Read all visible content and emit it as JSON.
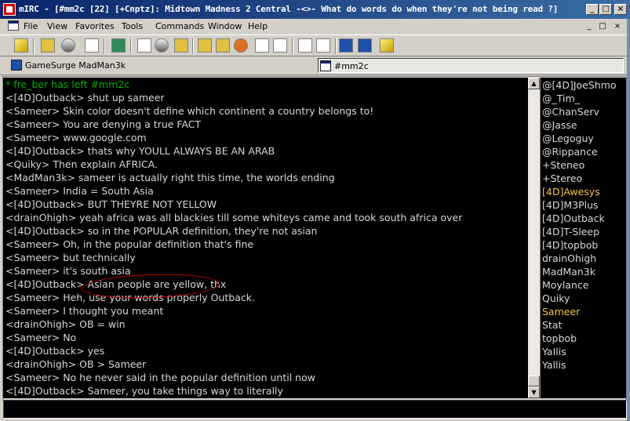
{
  "window": {
    "title": "mIRC - [#mm2c [22] [+Cnptz]: Midtown Madness 2 Central -<>- What do words do when they're not being read ?]",
    "controls": [
      "_",
      "□",
      "×"
    ]
  },
  "menubar": {
    "items": [
      "File",
      "View",
      "Favorites",
      "Tools",
      "Commands",
      "Window",
      "Help"
    ],
    "mdi_controls": [
      "_",
      "□",
      "×"
    ]
  },
  "switchbar": {
    "tabs": [
      {
        "label": "GameSurge MadMan3k"
      },
      {
        "label": "#mm2c"
      }
    ]
  },
  "chat": {
    "lines": [
      "* fre_ber has left #mm2c",
      "<[4D]Outback> shut up sameer",
      "<Sameer> Skin color doesn't define which continent a country belongs to!",
      "<Sameer> You are denying a true FACT",
      "<Sameer> www.google.com",
      "<[4D]Outback> thats why YOULL ALWAYS BE AN ARAB",
      "<Quiky> Then explain AFRICA.",
      "<MadMan3k> sameer is actually right this time, the worlds ending",
      "<Sameer> India = South Asia",
      "<[4D]Outback> BUT THEYRE NOT YELLOW",
      "<drainOhigh> yeah africa was all blackies till some whiteys came and took south africa over",
      "<[4D]Outback> so in the POPULAR definition, they're not asian",
      "<Sameer> Oh, in the popular definition that's fine",
      "<Sameer> but technically",
      "<Sameer> it's south asia",
      "<[4D]Outback> Asian people are yellow, thx",
      "<Sameer> Heh, use your words properly Outback.",
      "<Sameer> I thought you meant",
      "<drainOhigh> OB = win",
      "<Sameer> No",
      "<[4D]Outback> yes",
      "<drainOhigh> OB > Sameer",
      "<Sameer> No he never said in the popular definition until now",
      "<[4D]Outback> Sameer, you take things way to literally"
    ]
  },
  "nicklist": {
    "nicks": [
      "@[4D]JoeShmo",
      "@_Tim_",
      "@ChanServ",
      "@Jasse",
      "@Legoguy",
      "@Rippance",
      "+Steneo",
      "+Stereo",
      "[4D]Awesys",
      "[4D]M3Plus",
      "[4D]Outback",
      "[4D]T-Sleep",
      "[4D]topbob",
      "drainOhigh",
      "MadMan3k",
      "Moylance",
      "Quiky",
      "Sameer",
      "Stat",
      "topbob",
      "YaIlis",
      "Yallis"
    ],
    "highlighted": [
      "[4D]Awesys",
      "Sameer"
    ]
  },
  "editbox": {
    "value": ""
  },
  "colors": {
    "chat_bg": "#000000",
    "chat_text": "#d8d8d8",
    "part_text": "#00b000",
    "nick_highlight": "#ffc040",
    "annotation": "#d00000"
  }
}
